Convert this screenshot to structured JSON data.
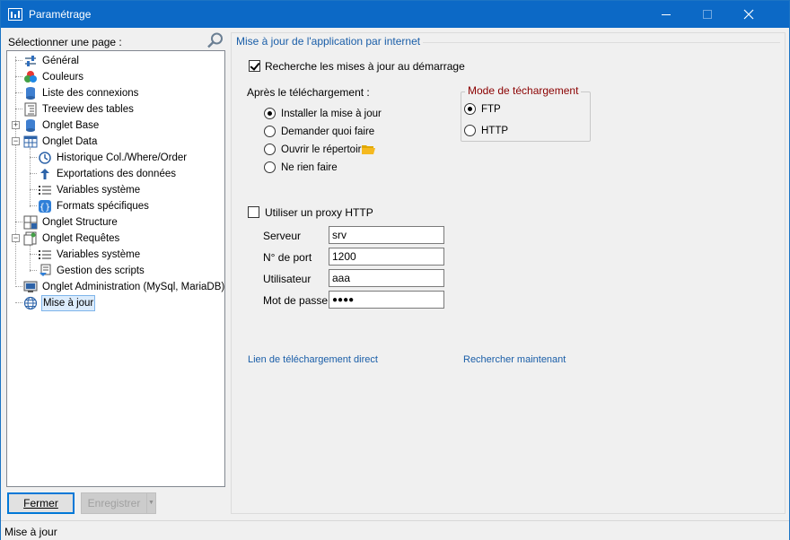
{
  "window": {
    "title": "Paramétrage"
  },
  "sidebar": {
    "label": "Sélectionner une page :",
    "items": [
      {
        "label": "Général",
        "icon": "general-icon"
      },
      {
        "label": "Couleurs",
        "icon": "palette-icon"
      },
      {
        "label": "Liste des connexions",
        "icon": "database-icon"
      },
      {
        "label": "Treeview des tables",
        "icon": "treeview-icon"
      },
      {
        "label": "Onglet Base",
        "icon": "database-icon",
        "expander": "+"
      },
      {
        "label": "Onglet Data",
        "icon": "grid-icon",
        "expander": "−"
      },
      {
        "label": "Historique Col./Where/Order",
        "icon": "history-icon"
      },
      {
        "label": "Exportations des données",
        "icon": "export-arrow-icon"
      },
      {
        "label": "Variables système",
        "icon": "list-icon"
      },
      {
        "label": "Formats spécifiques",
        "icon": "braces-icon"
      },
      {
        "label": "Onglet Structure",
        "icon": "structure-icon"
      },
      {
        "label": "Onglet Requêtes",
        "icon": "query-icon",
        "expander": "−"
      },
      {
        "label": "Variables système",
        "icon": "list-icon"
      },
      {
        "label": "Gestion des scripts",
        "icon": "script-icon"
      },
      {
        "label": "Onglet Administration (MySql, MariaDB)",
        "icon": "admin-icon"
      },
      {
        "label": "Mise à jour",
        "icon": "globe-icon",
        "selected": true
      }
    ]
  },
  "buttons": {
    "close": "Fermer",
    "save": "Enregistrer"
  },
  "status": {
    "text": "Mise à jour"
  },
  "main": {
    "title": "Mise à jour de l'application par internet",
    "check_updates_label": "Recherche les mises à jour au démarrage",
    "check_updates_checked": true,
    "after_download_label": "Après le téléchargement :",
    "after_download_options": [
      "Installer la mise à jour",
      "Demander quoi faire",
      "Ouvrir le répertoire",
      "Ne rien faire"
    ],
    "after_download_selected": "Installer la mise à jour",
    "mode_title": "Mode de téchargement",
    "mode_options": [
      "FTP",
      "HTTP"
    ],
    "mode_selected": "FTP",
    "proxy": {
      "use_label": "Utiliser un proxy HTTP",
      "use_checked": false,
      "server_label": "Serveur",
      "server_value": "srv",
      "port_label": "N° de port",
      "port_value": "1200",
      "user_label": "Utilisateur",
      "user_value": "aaa",
      "password_label": "Mot de passe",
      "password_value": "●●●●"
    },
    "direct_link": "Lien de téléchargement direct",
    "search_now": "Rechercher maintenant"
  },
  "colors": {
    "titlebar": "#0c69c6",
    "link": "#1a5ea8",
    "mode_title": "#8b0000",
    "selection": "#dcecfc"
  }
}
